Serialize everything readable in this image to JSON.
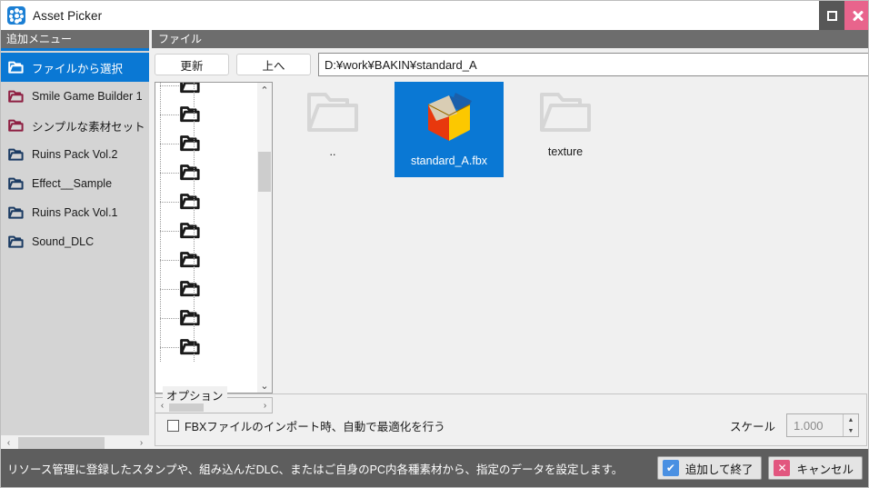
{
  "window": {
    "title": "Asset Picker",
    "app_icon": "asset-picker-icon",
    "maximize_label": "",
    "close_label": ""
  },
  "sidebar": {
    "header": "追加メニュー",
    "accent_color": "#0a78d4",
    "items": [
      {
        "label": "ファイルから選択",
        "icon": "folder-icon",
        "selected": true,
        "color": "#ffffff"
      },
      {
        "label": "Smile Game Builder 1",
        "icon": "folder-icon",
        "selected": false,
        "color": "#8e1f42"
      },
      {
        "label": "シンプルな素材セット",
        "icon": "folder-icon",
        "selected": false,
        "color": "#8e1f42"
      },
      {
        "label": "Ruins Pack Vol.2",
        "icon": "folder-icon",
        "selected": false,
        "color": "#1b3b63"
      },
      {
        "label": "Effect__Sample",
        "icon": "folder-icon",
        "selected": false,
        "color": "#1b3b63"
      },
      {
        "label": "Ruins Pack Vol.1",
        "icon": "folder-icon",
        "selected": false,
        "color": "#1b3b63"
      },
      {
        "label": "Sound_DLC",
        "icon": "folder-icon",
        "selected": false,
        "color": "#1b3b63"
      }
    ],
    "hscroll": {
      "left_arrow": "‹",
      "right_arrow": "›"
    }
  },
  "file_panel": {
    "header": "ファイル",
    "toolbar": {
      "refresh_label": "更新",
      "up_label": "上へ",
      "path_value": "D:¥work¥BAKIN¥standard_A",
      "path_placeholder": ""
    },
    "tree": {
      "node_count": 10,
      "vscroll": {
        "up_arrow": "⌃",
        "down_arrow": "⌄"
      },
      "hscroll": {
        "left_arrow": "‹",
        "right_arrow": "›"
      }
    },
    "files": [
      {
        "label": "..",
        "icon": "folder-icon",
        "selected": false
      },
      {
        "label": "standard_A.fbx",
        "icon": "fbx-model-icon",
        "selected": true
      },
      {
        "label": "texture",
        "icon": "folder-icon",
        "selected": false
      }
    ],
    "options": {
      "legend": "オプション",
      "checkbox_label": "FBXファイルのインポート時、自動で最適化を行う",
      "checkbox_checked": false,
      "scale_label": "スケール",
      "scale_value": "1.000",
      "scale_disabled": true,
      "spin_up": "▲",
      "spin_down": "▼"
    }
  },
  "statusbar": {
    "message": "リソース管理に登録したスタンプや、組み込んだDLC、またはご自身のPC内各種素材から、指定のデータを設定します。",
    "confirm_label": "追加して終了",
    "confirm_icon": "check-icon",
    "confirm_glyph": "✔",
    "cancel_label": "キャンセル",
    "cancel_icon": "close-icon",
    "cancel_glyph": "✕"
  }
}
